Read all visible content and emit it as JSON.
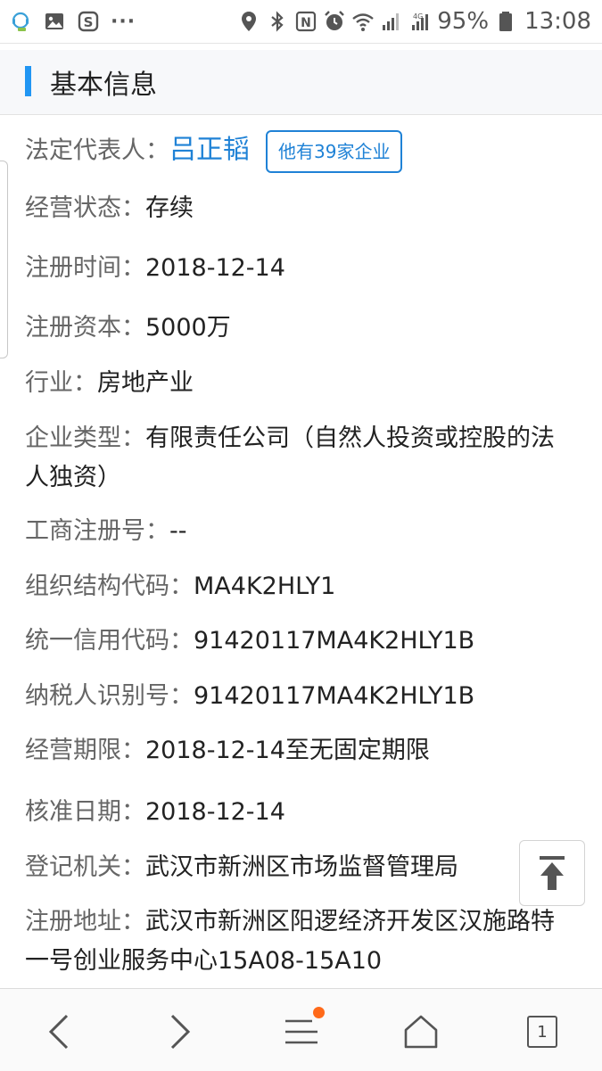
{
  "status_bar": {
    "battery_percent": "95%",
    "time": "13:08",
    "network_label": "4G",
    "icons_left": [
      "assistant-icon",
      "gallery-icon",
      "s-app-icon",
      "more-dots-icon"
    ],
    "icons_right": [
      "location-icon",
      "bluetooth-icon",
      "nfc-icon",
      "alarm-icon",
      "wifi-icon",
      "signal-icon",
      "battery-icon"
    ]
  },
  "section": {
    "title": "基本信息"
  },
  "legal_rep": {
    "label": "法定代表人：",
    "name": "吕正韬",
    "badge": "他有39家企业"
  },
  "fields": [
    {
      "label": "经营状态：",
      "value": "存续"
    },
    {
      "label": "注册时间：",
      "value": "2018-12-14"
    },
    {
      "label": "注册资本：",
      "value": "5000万"
    },
    {
      "label": "行业：",
      "value": "房地产业"
    },
    {
      "label": "企业类型：",
      "value": "有限责任公司（自然人投资或控股的法人独资）"
    },
    {
      "label": "工商注册号：",
      "value": "--"
    },
    {
      "label": "组织结构代码：",
      "value": "MA4K2HLY1"
    },
    {
      "label": "统一信用代码：",
      "value": "91420117MA4K2HLY1B"
    },
    {
      "label": "纳税人识别号：",
      "value": "91420117MA4K2HLY1B"
    },
    {
      "label": "经营期限：",
      "value": "2018-12-14至无固定期限"
    },
    {
      "label": "核准日期：",
      "value": "2018-12-14"
    },
    {
      "label": "登记机关：",
      "value": "武汉市新洲区市场监督管理局"
    },
    {
      "label": "注册地址：",
      "value": "武汉市新洲区阳逻经济开发区汉施路特一号创业服务中心15A08-15A10"
    }
  ],
  "bottom_nav": {
    "tabs_count": "1"
  }
}
